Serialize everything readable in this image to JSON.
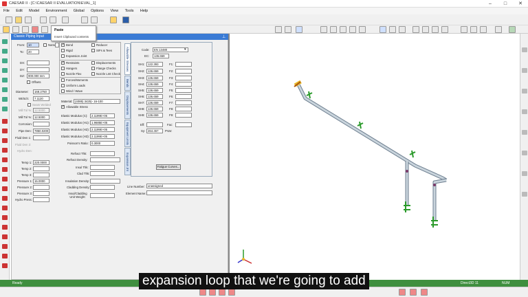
{
  "window": {
    "title": "CAESAR II - [C:\\CAESAR II EVALUATION\\EVAL_1]"
  },
  "menu": [
    "File",
    "Edit",
    "Model",
    "Environment",
    "Global",
    "Options",
    "View",
    "Tools",
    "Help"
  ],
  "clipboard_popup": {
    "item": "Paste",
    "tooltip": "Insert Clipboard contents"
  },
  "panel": {
    "title": "Classic Piping Input",
    "from_label": "From:",
    "from_value": "10",
    "to_label": "To:",
    "to_value": "20",
    "name_label": "Name",
    "dx_label": "DX:",
    "dy_label": "DY:",
    "dz_label": "DZ:",
    "dz_value": "900.000 mm",
    "offsets_label": "Offsets",
    "diameter_label": "Diameter:",
    "diameter_value": "168.2750",
    "wt_label": "Wt/Sch:",
    "wt_value": "7.1120",
    "seam_label": "Seam Welded",
    "mill_tol_label": "Mill Tol %:",
    "mill_tol_value": "12.5000",
    "mill_tol2_label": "Mill Tol %:",
    "mill_tol2_value": "12.5000",
    "corrosion_label": "Corrosion:",
    "pipe_den_label": "Pipe Den:",
    "pipe_den_value": "7850.0200",
    "fluid_den_label": "Fluid Den 1:",
    "fluid_den2_label": "Fluid Den 2:",
    "hydro_den_label": "Hydro Den:",
    "temp1_label": "Temp 1:",
    "temp1_value": "220.0000",
    "temp2_label": "Temp 2:",
    "temp3_label": "Temp 3:",
    "press1_label": "Pressure 1:",
    "press1_value": "15.0000",
    "press2_label": "Pressure 2:",
    "press3_label": "Pressure 3:",
    "hydro_press_label": "Hydro Press:",
    "checks": [
      {
        "label": "Bend",
        "on": true
      },
      {
        "label": "Rigid",
        "on": false
      },
      {
        "label": "Expansion Joint",
        "on": false
      },
      {
        "label": "Reducer",
        "on": false
      },
      {
        "label": "SIFs & Tees",
        "on": false
      },
      {
        "label": "Restraints",
        "on": true
      },
      {
        "label": "Hangers",
        "on": false
      },
      {
        "label": "Nozzle Flex",
        "on": false
      },
      {
        "label": "Displacements",
        "on": false
      },
      {
        "label": "Flange Checks",
        "on": false
      },
      {
        "label": "Nozzle Lmt Check",
        "on": false
      },
      {
        "label": "Forces/Moments",
        "on": false
      },
      {
        "label": "Uniform Loads",
        "on": false
      },
      {
        "label": "Wind / Wave",
        "on": false
      }
    ],
    "material_label": "Material:",
    "material_value": "(4085) 3425)- 16-100",
    "allowable_stress_label": "Allowable Stress",
    "elastic": [
      {
        "label": "Elastic Modulus (C):",
        "value": "2.1199E+05"
      },
      {
        "label": "Elastic Modulus (H1):",
        "value": "1.9685E+05"
      },
      {
        "label": "Elastic Modulus (H2):",
        "value": "2.1199E+05"
      },
      {
        "label": "Elastic Modulus (H3):",
        "value": "2.1199E+05"
      },
      {
        "label": "Poisson's Ratio:",
        "value": "0.3000"
      }
    ],
    "refract_thk_label": "Refract Thk:",
    "refract_den_label": "Refract Density:",
    "insul_thk_label": "Insul Thk:",
    "clad_thk_label": "Clad Thk:",
    "insul_den_label": "Insulation Density:",
    "clad_den_label": "Cladding Density:",
    "insul_clad_label": "Insul/Cladding Unit Weight:",
    "tabs": [
      "Allowable Stresses",
      "Bends",
      "Displacements",
      "Equipment Limits",
      "Expansion Jnt"
    ],
    "code_label": "Code:",
    "code_value": "EN 13480",
    "ec_label": "EC:",
    "ec_value": "136.659",
    "sh": [
      {
        "label": "SH1:",
        "value": "122.393"
      },
      {
        "label": "SH2:",
        "value": "136.659"
      },
      {
        "label": "SH3:",
        "value": "136.659"
      },
      {
        "label": "SH4:",
        "value": "136.659"
      },
      {
        "label": "SH5:",
        "value": "136.659"
      },
      {
        "label": "SH6:",
        "value": "136.659"
      },
      {
        "label": "SH7:",
        "value": "136.659"
      },
      {
        "label": "SH8:",
        "value": "136.659"
      },
      {
        "label": "SH9:",
        "value": "136.659"
      }
    ],
    "f_labels": [
      "F1:",
      "F2:",
      "F3:",
      "F4:",
      "F5:",
      "F6:",
      "F7:",
      "F8:",
      "F9:"
    ],
    "eff_label": "Eff:",
    "fac_label": "Fac:",
    "sy_label": "Sy:",
    "sy_value": "264.457",
    "pvar_label": "PVar:",
    "fatigue_button": "Fatigue Curves...",
    "line_number_label": "Line Number:",
    "line_number_value": "unassigned",
    "element_name_label": "Element Name:"
  },
  "status": {
    "left": "Ready",
    "renderer": "Direct3D 11",
    "mode": "NUM"
  },
  "caption": "expansion loop that we're going to add"
}
